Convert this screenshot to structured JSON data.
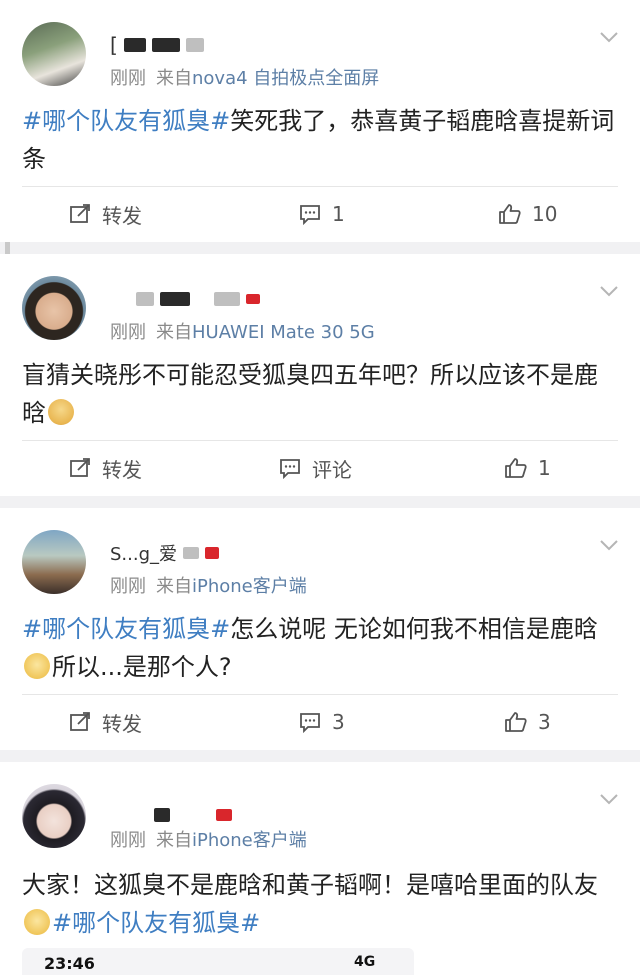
{
  "posts": [
    {
      "meta_time": "刚刚",
      "meta_source": "来自",
      "meta_device": "nova4 自拍极点全面屏",
      "text_topic": "#哪个队友有狐臭#",
      "text_body": "笑死我了，恭喜黄子韬鹿晗喜提新词条",
      "actions": {
        "repost": "转发",
        "comment": "1",
        "like": "10"
      }
    },
    {
      "meta_time": "刚刚",
      "meta_source": "来自",
      "meta_device": "HUAWEI Mate 30 5G",
      "text_body": "盲猜关晓彤不可能忍受狐臭四五年吧？所以应该不是鹿晗",
      "emoji": "doge-emoji",
      "actions": {
        "repost": "转发",
        "comment": "评论",
        "like": "1"
      }
    },
    {
      "username_partial": "S...g_爱",
      "meta_time": "刚刚",
      "meta_source": "来自",
      "meta_device": "iPhone客户端",
      "text_topic": "#哪个队友有狐臭#",
      "text_body_1": "怎么说呢 无论如何我不相信是鹿晗",
      "text_body_2": "所以...是那个人?",
      "emoji": "speechless-emoji",
      "actions": {
        "repost": "转发",
        "comment": "3",
        "like": "3"
      }
    },
    {
      "meta_time": "刚刚",
      "meta_source": "来自",
      "meta_device": "iPhone客户端",
      "text_body": "大家！这狐臭不是鹿晗和黄子韬啊！是嘻哈里面的队友",
      "text_topic": "#哪个队友有狐臭#",
      "emoji": "thinking-emoji",
      "actions": null
    }
  ],
  "phone_strip": {
    "time": "23:46",
    "network": "4G"
  },
  "colors": {
    "topic": "#3f7ec2",
    "meta": "#8a8a8a",
    "action": "#555555"
  }
}
